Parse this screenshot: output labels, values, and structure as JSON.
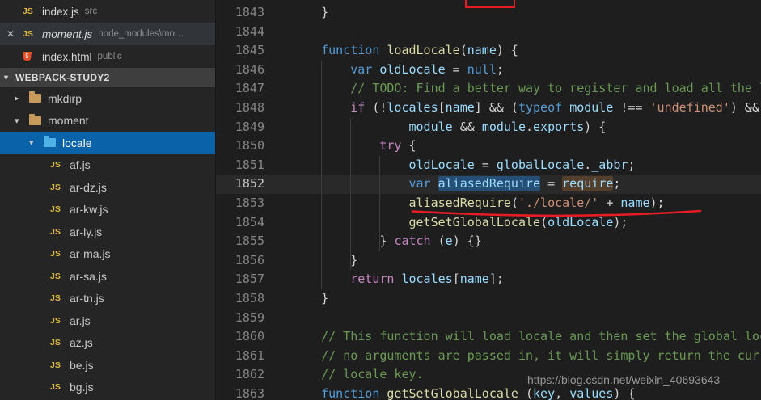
{
  "colors": {
    "accent_blue": "#0a62a8",
    "annotation_red": "#e81c24",
    "editor_bg": "#1e1e1e",
    "sidebar_bg": "#252526",
    "word_highlight_blue": "#264f78",
    "word_highlight_brown": "#533f2b"
  },
  "sidebar": {
    "open_editors": [
      {
        "name": "index.js",
        "path": "src",
        "icon": "js",
        "closable": false,
        "active": false,
        "italic": false
      },
      {
        "name": "moment.js",
        "path": "node_modules\\mo…",
        "icon": "js",
        "closable": true,
        "active": true,
        "italic": true
      },
      {
        "name": "index.html",
        "path": "public",
        "icon": "html",
        "closable": false,
        "active": false,
        "italic": false
      }
    ],
    "section_header": {
      "label": "WEBPACK-STUDY2",
      "chevron": "▾"
    },
    "close_icon": "✕",
    "tree": [
      {
        "label": "mkdirp",
        "kind": "folder",
        "level": 0,
        "chevron": "▸",
        "open": false,
        "selected": false
      },
      {
        "label": "moment",
        "kind": "folder",
        "level": 0,
        "chevron": "▾",
        "open": true,
        "selected": false
      },
      {
        "label": "locale",
        "kind": "folder",
        "level": 1,
        "chevron": "▾",
        "open": true,
        "selected": true
      },
      {
        "label": "af.js",
        "kind": "js",
        "level": 2
      },
      {
        "label": "ar-dz.js",
        "kind": "js",
        "level": 2
      },
      {
        "label": "ar-kw.js",
        "kind": "js",
        "level": 2
      },
      {
        "label": "ar-ly.js",
        "kind": "js",
        "level": 2
      },
      {
        "label": "ar-ma.js",
        "kind": "js",
        "level": 2
      },
      {
        "label": "ar-sa.js",
        "kind": "js",
        "level": 2
      },
      {
        "label": "ar-tn.js",
        "kind": "js",
        "level": 2
      },
      {
        "label": "ar.js",
        "kind": "js",
        "level": 2
      },
      {
        "label": "az.js",
        "kind": "js",
        "level": 2
      },
      {
        "label": "be.js",
        "kind": "js",
        "level": 2
      },
      {
        "label": "bg.js",
        "kind": "js",
        "level": 2
      }
    ]
  },
  "editor": {
    "current_line": 1852,
    "lines": [
      {
        "num": 1843,
        "tokens": [
          {
            "t": "    }",
            "c": "pun"
          }
        ]
      },
      {
        "num": 1844,
        "tokens": []
      },
      {
        "num": 1845,
        "tokens": [
          {
            "t": "    ",
            "c": "pun"
          },
          {
            "t": "function",
            "c": "kw"
          },
          {
            "t": " ",
            "c": "pun"
          },
          {
            "t": "loadLocale",
            "c": "fn"
          },
          {
            "t": "(",
            "c": "pun"
          },
          {
            "t": "name",
            "c": "var"
          },
          {
            "t": ") {",
            "c": "pun"
          }
        ]
      },
      {
        "num": 1846,
        "tokens": [
          {
            "t": "        ",
            "c": "pun"
          },
          {
            "t": "var",
            "c": "kw"
          },
          {
            "t": " ",
            "c": "pun"
          },
          {
            "t": "oldLocale",
            "c": "var"
          },
          {
            "t": " = ",
            "c": "pun"
          },
          {
            "t": "null",
            "c": "kw"
          },
          {
            "t": ";",
            "c": "pun"
          }
        ]
      },
      {
        "num": 1847,
        "tokens": [
          {
            "t": "        ",
            "c": "pun"
          },
          {
            "t": "// TODO: Find a better way to register and load all the locales in Node",
            "c": "cmt"
          }
        ]
      },
      {
        "num": 1848,
        "tokens": [
          {
            "t": "        ",
            "c": "pun"
          },
          {
            "t": "if",
            "c": "ctrl"
          },
          {
            "t": " (!",
            "c": "pun"
          },
          {
            "t": "locales",
            "c": "var"
          },
          {
            "t": "[",
            "c": "pun"
          },
          {
            "t": "name",
            "c": "var"
          },
          {
            "t": "] && (",
            "c": "pun"
          },
          {
            "t": "typeof",
            "c": "kw"
          },
          {
            "t": " ",
            "c": "pun"
          },
          {
            "t": "module",
            "c": "var"
          },
          {
            "t": " !== ",
            "c": "pun"
          },
          {
            "t": "'undefined'",
            "c": "str"
          },
          {
            "t": ") &&",
            "c": "pun"
          }
        ]
      },
      {
        "num": 1849,
        "tokens": [
          {
            "t": "                ",
            "c": "pun"
          },
          {
            "t": "module",
            "c": "var"
          },
          {
            "t": " && ",
            "c": "pun"
          },
          {
            "t": "module",
            "c": "var"
          },
          {
            "t": ".",
            "c": "pun"
          },
          {
            "t": "exports",
            "c": "var"
          },
          {
            "t": ") {",
            "c": "pun"
          }
        ]
      },
      {
        "num": 1850,
        "tokens": [
          {
            "t": "            ",
            "c": "pun"
          },
          {
            "t": "try",
            "c": "ctrl"
          },
          {
            "t": " {",
            "c": "pun"
          }
        ]
      },
      {
        "num": 1851,
        "tokens": [
          {
            "t": "                ",
            "c": "pun"
          },
          {
            "t": "oldLocale",
            "c": "var"
          },
          {
            "t": " = ",
            "c": "pun"
          },
          {
            "t": "globalLocale",
            "c": "var"
          },
          {
            "t": ".",
            "c": "pun"
          },
          {
            "t": "_abbr",
            "c": "var"
          },
          {
            "t": ";",
            "c": "pun"
          }
        ]
      },
      {
        "num": 1852,
        "tokens": [
          {
            "t": "                ",
            "c": "pun"
          },
          {
            "t": "var",
            "c": "kw"
          },
          {
            "t": " ",
            "c": "pun"
          },
          {
            "t": "aliasedRequire",
            "c": "var",
            "h": "blue"
          },
          {
            "t": " = ",
            "c": "pun"
          },
          {
            "t": "require",
            "c": "var",
            "h": "brown"
          },
          {
            "t": ";",
            "c": "pun"
          }
        ]
      },
      {
        "num": 1853,
        "tokens": [
          {
            "t": "                ",
            "c": "pun"
          },
          {
            "t": "aliasedRequire",
            "c": "fn"
          },
          {
            "t": "(",
            "c": "pun"
          },
          {
            "t": "'./locale/'",
            "c": "str"
          },
          {
            "t": " + ",
            "c": "pun"
          },
          {
            "t": "name",
            "c": "var"
          },
          {
            "t": ");",
            "c": "pun"
          }
        ]
      },
      {
        "num": 1854,
        "tokens": [
          {
            "t": "                ",
            "c": "pun"
          },
          {
            "t": "getSetGlobalLocale",
            "c": "fn"
          },
          {
            "t": "(",
            "c": "pun"
          },
          {
            "t": "oldLocale",
            "c": "var"
          },
          {
            "t": ");",
            "c": "pun"
          }
        ]
      },
      {
        "num": 1855,
        "tokens": [
          {
            "t": "            } ",
            "c": "pun"
          },
          {
            "t": "catch",
            "c": "ctrl"
          },
          {
            "t": " (",
            "c": "pun"
          },
          {
            "t": "e",
            "c": "var"
          },
          {
            "t": ") {}",
            "c": "pun"
          }
        ]
      },
      {
        "num": 1856,
        "tokens": [
          {
            "t": "        }",
            "c": "pun"
          }
        ]
      },
      {
        "num": 1857,
        "tokens": [
          {
            "t": "        ",
            "c": "pun"
          },
          {
            "t": "return",
            "c": "ctrl"
          },
          {
            "t": " ",
            "c": "pun"
          },
          {
            "t": "locales",
            "c": "var"
          },
          {
            "t": "[",
            "c": "pun"
          },
          {
            "t": "name",
            "c": "var"
          },
          {
            "t": "];",
            "c": "pun"
          }
        ]
      },
      {
        "num": 1858,
        "tokens": [
          {
            "t": "    }",
            "c": "pun"
          }
        ]
      },
      {
        "num": 1859,
        "tokens": []
      },
      {
        "num": 1860,
        "tokens": [
          {
            "t": "    ",
            "c": "pun"
          },
          {
            "t": "// This function will load locale and then set the global locale.  If",
            "c": "cmt"
          }
        ]
      },
      {
        "num": 1861,
        "tokens": [
          {
            "t": "    ",
            "c": "pun"
          },
          {
            "t": "// no arguments are passed in, it will simply return the current global",
            "c": "cmt"
          }
        ]
      },
      {
        "num": 1862,
        "tokens": [
          {
            "t": "    ",
            "c": "pun"
          },
          {
            "t": "// locale key.",
            "c": "cmt"
          }
        ]
      },
      {
        "num": 1863,
        "tokens": [
          {
            "t": "    ",
            "c": "pun"
          },
          {
            "t": "function",
            "c": "kw"
          },
          {
            "t": " ",
            "c": "pun"
          },
          {
            "t": "getSetGlobalLocale",
            "c": "fn"
          },
          {
            "t": " (",
            "c": "pun"
          },
          {
            "t": "key",
            "c": "var"
          },
          {
            "t": ", ",
            "c": "pun"
          },
          {
            "t": "values",
            "c": "var"
          },
          {
            "t": ") {",
            "c": "pun"
          }
        ]
      }
    ]
  },
  "annotations": {
    "watermark": "https://blog.csdn.net/weixin_40693643"
  }
}
